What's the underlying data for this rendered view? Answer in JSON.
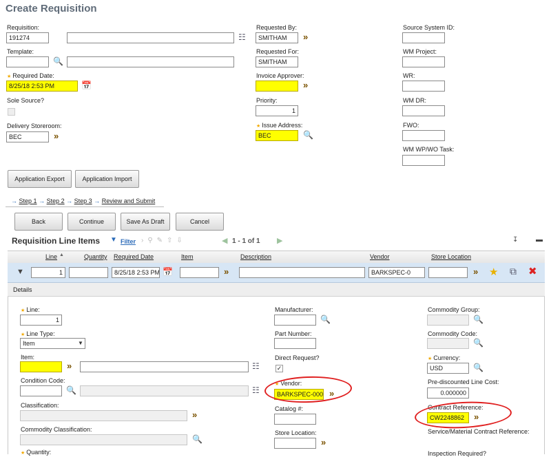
{
  "page_title": "Create Requisition",
  "header": {
    "requisition": {
      "label": "Requisition:",
      "value": "191274",
      "desc": ""
    },
    "template": {
      "label": "Template:",
      "value": "",
      "desc": ""
    },
    "required_date": {
      "label": "Required Date:",
      "value": "8/25/18 2:53 PM"
    },
    "sole_source": {
      "label": "Sole Source?"
    },
    "delivery_storeroom": {
      "label": "Delivery Storeroom:",
      "value": "BEC"
    },
    "requested_by": {
      "label": "Requested By:",
      "value": "SMITHAM"
    },
    "requested_for": {
      "label": "Requested For:",
      "value": "SMITHAM"
    },
    "invoice_approver": {
      "label": "Invoice Approver:",
      "value": ""
    },
    "priority": {
      "label": "Priority:",
      "value": "1"
    },
    "issue_address": {
      "label": "Issue Address:",
      "value": "BEC"
    },
    "source_system_id": {
      "label": "Source System ID:",
      "value": ""
    },
    "wm_project": {
      "label": "WM Project:",
      "value": ""
    },
    "wr": {
      "label": "WR:",
      "value": ""
    },
    "wm_dr": {
      "label": "WM DR:",
      "value": ""
    },
    "fwo": {
      "label": "FWO:",
      "value": ""
    },
    "wm_wp_wo_task": {
      "label": "WM WP/WO Task:",
      "value": ""
    }
  },
  "buttons": {
    "app_export": "Application Export",
    "app_import": "Application Import",
    "back": "Back",
    "continue": "Continue",
    "save_draft": "Save As Draft",
    "cancel": "Cancel"
  },
  "steps": [
    "Step 1",
    "Step 2",
    "Step 3",
    "Review and Submit"
  ],
  "lines": {
    "title": "Requisition Line Items",
    "filter": "Filter",
    "pager": "1 - 1 of 1",
    "columns": [
      "Line",
      "Quantity",
      "Required Date",
      "Item",
      "Description",
      "Vendor",
      "Store Location"
    ],
    "row": {
      "line": "1",
      "quantity": "",
      "required_date": "8/25/18 2:53 PM",
      "item": "",
      "description": "",
      "vendor": "BARKSPEC-0",
      "store_location": ""
    }
  },
  "details": {
    "heading": "Details",
    "line": {
      "label": "Line:",
      "value": "1"
    },
    "line_type": {
      "label": "Line Type:",
      "value": "Item"
    },
    "item": {
      "label": "Item:",
      "value": "",
      "desc": ""
    },
    "condition_code": {
      "label": "Condition Code:",
      "value": "",
      "desc": ""
    },
    "classification": {
      "label": "Classification:",
      "value": ""
    },
    "commodity_classification": {
      "label": "Commodity Classification:",
      "value": ""
    },
    "quantity": {
      "label": "Quantity:"
    },
    "manufacturer": {
      "label": "Manufacturer:",
      "value": ""
    },
    "part_number": {
      "label": "Part Number:",
      "value": ""
    },
    "direct_request": {
      "label": "Direct Request?"
    },
    "vendor": {
      "label": "Vendor:",
      "value": "BARKSPEC-000"
    },
    "catalog": {
      "label": "Catalog #:",
      "value": ""
    },
    "store_location": {
      "label": "Store Location:",
      "value": ""
    },
    "commodity_group": {
      "label": "Commodity Group:",
      "value": ""
    },
    "commodity_code": {
      "label": "Commodity Code:",
      "value": ""
    },
    "currency": {
      "label": "Currency:",
      "value": "USD"
    },
    "pre_discounted_cost": {
      "label": "Pre-discounted Line Cost:",
      "value": "0.000000"
    },
    "contract_reference": {
      "label": "Contract Reference:",
      "value": "CW2248862"
    },
    "service_contract_reference": {
      "label": "Service/Material Contract Reference:"
    },
    "inspection_required": {
      "label": "Inspection Required?"
    }
  }
}
